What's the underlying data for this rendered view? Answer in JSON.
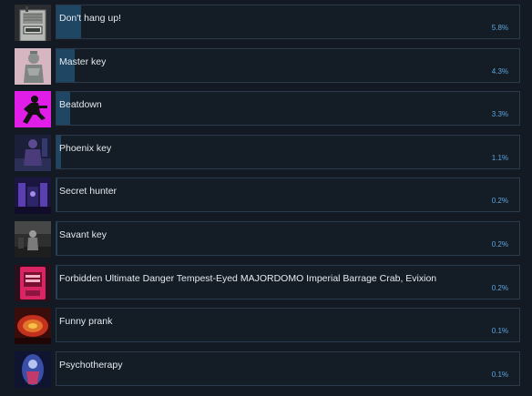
{
  "achievements": [
    {
      "name": "Don't hang up!",
      "percent_label": "5.8%",
      "percent": 5.8,
      "icon": "walkie-talkie-icon"
    },
    {
      "name": "Master key",
      "percent_label": "4.3%",
      "percent": 4.3,
      "icon": "statue-icon"
    },
    {
      "name": "Beatdown",
      "percent_label": "3.3%",
      "percent": 3.3,
      "icon": "fighter-silhouette-icon"
    },
    {
      "name": "Phoenix key",
      "percent_label": "1.1%",
      "percent": 1.1,
      "icon": "dark-room-figure-icon"
    },
    {
      "name": "Secret hunter",
      "percent_label": "0.2%",
      "percent": 0.2,
      "icon": "purple-corridor-icon"
    },
    {
      "name": "Savant key",
      "percent_label": "0.2%",
      "percent": 0.2,
      "icon": "grey-room-figure-icon"
    },
    {
      "name": "Forbidden Ultimate Danger Tempest-Eyed MAJORDOMO Imperial Barrage Crab, Evixion",
      "percent_label": "0.2%",
      "percent": 0.2,
      "icon": "red-arcade-cabinet-icon"
    },
    {
      "name": "Funny prank",
      "percent_label": "0.1%",
      "percent": 0.1,
      "icon": "red-stage-icon"
    },
    {
      "name": "Psychotherapy",
      "percent_label": "0.1%",
      "percent": 0.1,
      "icon": "blue-portrait-icon"
    }
  ],
  "colors": {
    "background": "#131a24",
    "panel_border": "#2b3b4c",
    "bar_fill": "#1f4663",
    "percent_text": "#5da6de"
  }
}
